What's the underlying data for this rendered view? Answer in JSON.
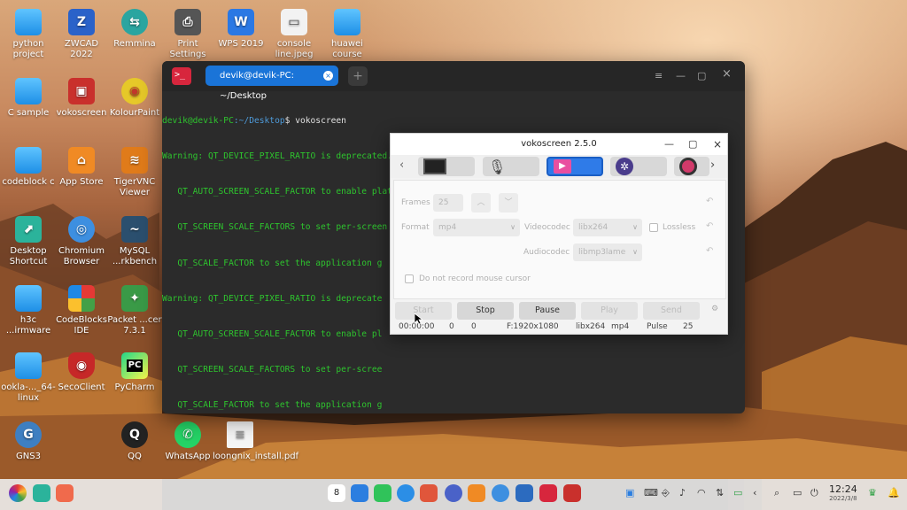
{
  "desktop": {
    "icons": [
      {
        "label": "python project",
        "icon": "folder-icon"
      },
      {
        "label": "ZWCAD 2022",
        "icon": "zwcad-icon"
      },
      {
        "label": "Remmina",
        "icon": "remmina-icon"
      },
      {
        "label": "Print Settings",
        "icon": "printer-icon"
      },
      {
        "label": "WPS 2019",
        "icon": "wps-icon"
      },
      {
        "label": "console line.jpeg",
        "icon": "image-file-icon"
      },
      {
        "label": "huawei course",
        "icon": "folder-icon"
      },
      {
        "label": "C sample",
        "icon": "folder-icon"
      },
      {
        "label": "vokoscreen",
        "icon": "vokoscreen-icon"
      },
      {
        "label": "KolourPaint",
        "icon": "kolourpaint-icon"
      },
      {
        "label": "codeblock c",
        "icon": "folder-icon"
      },
      {
        "label": "App Store",
        "icon": "appstore-icon"
      },
      {
        "label": "TigerVNC Viewer",
        "icon": "tigervnc-icon"
      },
      {
        "label": "Desktop Shortcut",
        "icon": "shortcut-icon"
      },
      {
        "label": "Chromium Browser",
        "icon": "chromium-icon"
      },
      {
        "label": "MySQL ...rkbench",
        "icon": "mysql-icon"
      },
      {
        "label": "h3c ...irmware",
        "icon": "folder-icon"
      },
      {
        "label": "CodeBlocks IDE",
        "icon": "codeblocks-icon"
      },
      {
        "label": "Packet ...cer 7.3.1",
        "icon": "packet-tracer-icon"
      },
      {
        "label": "ookla-..._64-linux",
        "icon": "folder-icon"
      },
      {
        "label": "SecoClient",
        "icon": "secoclient-icon"
      },
      {
        "label": "PyCharm",
        "icon": "pycharm-icon"
      },
      {
        "label": "GNS3",
        "icon": "gns3-icon"
      },
      {
        "label": "QQ",
        "icon": "qq-icon"
      },
      {
        "label": "WhatsApp",
        "icon": "whatsapp-icon"
      },
      {
        "label": "loongnix_install.pdf",
        "icon": "pdf-file-icon"
      }
    ]
  },
  "terminal": {
    "tab_title": "devik@devik-PC: ~/Desktop",
    "lines": [
      {
        "prompt": "devik@devik-PC",
        "path": ":~/Desktop",
        "cmd": "$ vokoscreen"
      },
      {
        "text": "Warning: QT_DEVICE_PIXEL_RATIO is deprecated. Instead use:"
      },
      {
        "text": "   QT_AUTO_SCREEN_SCALE_FACTOR to enable platform plugin controlled per-screen factors."
      },
      {
        "text": "   QT_SCREEN_SCALE_FACTORS to set per-screen DPI."
      },
      {
        "text": "   QT_SCALE_FACTOR to set the application g"
      },
      {
        "text": "Warning: QT_DEVICE_PIXEL_RATIO is deprecate"
      },
      {
        "text": "   QT_AUTO_SCREEN_SCALE_FACTOR to enable pl"
      },
      {
        "text": "   QT_SCREEN_SCALE_FACTORS to set per-scree"
      },
      {
        "text": "   QT_SCALE_FACTOR to set the application g"
      }
    ]
  },
  "vokoscreen": {
    "title": "vokoscreen 2.5.0",
    "frames_label": "Frames",
    "frames_value": "25",
    "format_label": "Format",
    "format_value": "mp4",
    "videocodec_label": "Videocodec",
    "videocodec_value": "libx264",
    "lossless_label": "Lossless",
    "audiocodec_label": "Audiocodec",
    "audiocodec_value": "libmp3lame",
    "no_mouse_label": "Do not record mouse cursor",
    "buttons": {
      "start": "Start",
      "stop": "Stop",
      "pause": "Pause",
      "play": "Play",
      "send": "Send"
    },
    "status": {
      "time": "00:00:00",
      "count1": "0",
      "count2": "0",
      "resolution": "F:1920x1080",
      "codec": "libx264",
      "format": "mp4",
      "audio": "Pulse",
      "fps": "25"
    }
  },
  "taskbar": {
    "time": "12:24",
    "date": "2022/3/8",
    "badge": "8"
  },
  "colors": {
    "terminal_green": "#2ec42e",
    "accent_blue": "#1a74d8",
    "voko_active_tab": "#2f7be8"
  }
}
